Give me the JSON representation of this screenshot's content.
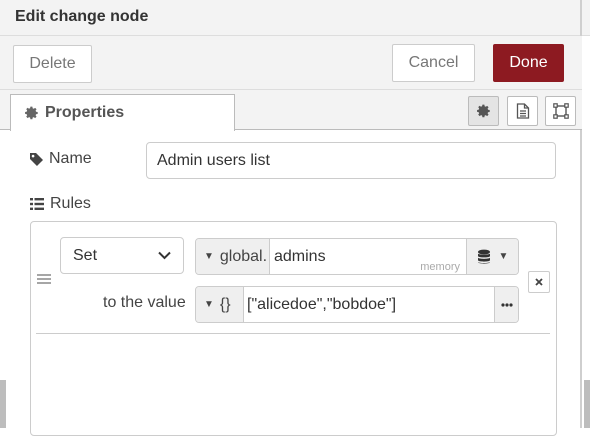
{
  "header": {
    "title": "Edit change node"
  },
  "toolbar": {
    "delete_label": "Delete",
    "cancel_label": "Cancel",
    "done_label": "Done",
    "done_color": "#8d1a21"
  },
  "tabs": {
    "properties_label": "Properties",
    "icons": [
      "gear-icon",
      "document-icon",
      "frame-icon"
    ]
  },
  "form": {
    "name_label": "Name",
    "name_value": "Admin users list",
    "rules_label": "Rules"
  },
  "rule": {
    "action": "Set",
    "target_type": "global.",
    "target_value": "admins",
    "target_store_hint": "memory",
    "to_value_label": "to the value",
    "value_type": "{}",
    "value": "[\"alicedoe\",\"bobdoe\"]"
  }
}
